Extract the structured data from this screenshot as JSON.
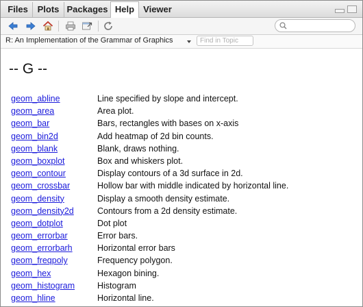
{
  "tabs": [
    {
      "label": "Files",
      "active": false
    },
    {
      "label": "Plots",
      "active": false
    },
    {
      "label": "Packages",
      "active": false
    },
    {
      "label": "Help",
      "active": true
    },
    {
      "label": "Viewer",
      "active": false
    }
  ],
  "toolbar": {
    "icons": [
      "back-arrow-icon",
      "forward-arrow-icon",
      "home-icon",
      "print-icon",
      "open-in-window-icon",
      "refresh-icon"
    ],
    "search_placeholder": ""
  },
  "topic": {
    "title": "R: An Implementation of the Grammar of Graphics",
    "find_placeholder": "Find in Topic"
  },
  "content": {
    "heading": "-- G --",
    "entries": [
      {
        "name": "geom_abline",
        "desc": "Line specified by slope and intercept."
      },
      {
        "name": "geom_area",
        "desc": "Area plot."
      },
      {
        "name": "geom_bar",
        "desc": "Bars, rectangles with bases on x-axis"
      },
      {
        "name": "geom_bin2d",
        "desc": "Add heatmap of 2d bin counts."
      },
      {
        "name": "geom_blank",
        "desc": "Blank, draws nothing."
      },
      {
        "name": "geom_boxplot",
        "desc": "Box and whiskers plot."
      },
      {
        "name": "geom_contour",
        "desc": "Display contours of a 3d surface in 2d."
      },
      {
        "name": "geom_crossbar",
        "desc": "Hollow bar with middle indicated by horizontal line."
      },
      {
        "name": "geom_density",
        "desc": "Display a smooth density estimate."
      },
      {
        "name": "geom_density2d",
        "desc": "Contours from a 2d density estimate."
      },
      {
        "name": "geom_dotplot",
        "desc": "Dot plot"
      },
      {
        "name": "geom_errorbar",
        "desc": "Error bars."
      },
      {
        "name": "geom_errorbarh",
        "desc": "Horizontal error bars"
      },
      {
        "name": "geom_freqpoly",
        "desc": "Frequency polygon."
      },
      {
        "name": "geom_hex",
        "desc": "Hexagon bining."
      },
      {
        "name": "geom_histogram",
        "desc": "Histogram"
      },
      {
        "name": "geom_hline",
        "desc": "Horizontal line."
      }
    ]
  },
  "colors": {
    "link": "#1a1adb",
    "arrow": "#3b7fd4",
    "home": "#c0392b"
  }
}
